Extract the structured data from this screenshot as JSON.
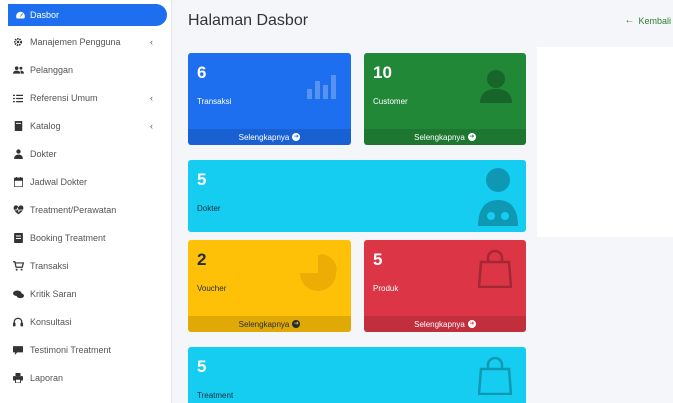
{
  "sidebar": {
    "items": [
      {
        "label": "Dasbor",
        "icon": "dashboard-icon",
        "chevron": false,
        "active": true
      },
      {
        "label": "Manajemen Pengguna",
        "icon": "gear-icon",
        "chevron": true
      },
      {
        "label": "Pelanggan",
        "icon": "users-icon",
        "chevron": false
      },
      {
        "label": "Referensi Umum",
        "icon": "list-icon",
        "chevron": true
      },
      {
        "label": "Katalog",
        "icon": "book-icon",
        "chevron": true
      },
      {
        "label": "Dokter",
        "icon": "doctor-icon",
        "chevron": false
      },
      {
        "label": "Jadwal Dokter",
        "icon": "calendar-icon",
        "chevron": false
      },
      {
        "label": "Treatment/Perawatan",
        "icon": "heartbeat-icon",
        "chevron": false
      },
      {
        "label": "Booking Treatment",
        "icon": "book-open-icon",
        "chevron": false
      },
      {
        "label": "Transaksi",
        "icon": "cart-icon",
        "chevron": false
      },
      {
        "label": "Kritik Saran",
        "icon": "comments-icon",
        "chevron": false
      },
      {
        "label": "Konsultasi",
        "icon": "headset-icon",
        "chevron": false
      },
      {
        "label": "Testimoni Treatment",
        "icon": "comment-icon",
        "chevron": false
      },
      {
        "label": "Laporan",
        "icon": "print-icon",
        "chevron": false
      }
    ],
    "chevron_glyph": "‹"
  },
  "header": {
    "title": "Halaman Dasbor",
    "back_label": "Kembali",
    "back_arrow": "←"
  },
  "boxes": {
    "transaksi": {
      "value": "6",
      "label": "Transaksi",
      "footer": "Selengkapnya",
      "icon": "bar-chart-icon",
      "color": "#1d6ff0"
    },
    "customer": {
      "value": "10",
      "label": "Customer",
      "footer": "Selengkapnya",
      "icon": "user-icon",
      "color": "#218838"
    },
    "dokter": {
      "value": "5",
      "label": "Dokter",
      "icon": "doctor-icon",
      "color": "#14cdf0"
    },
    "voucher": {
      "value": "2",
      "label": "Voucher",
      "footer": "Selengkapnya",
      "icon": "pie-chart-icon",
      "color": "#ffc107"
    },
    "produk": {
      "value": "5",
      "label": "Produk",
      "footer": "Selengkapnya",
      "icon": "shopping-bag-icon",
      "color": "#dc3545"
    },
    "treatment": {
      "value": "5",
      "label": "Treatment",
      "icon": "shopping-bag-icon",
      "color": "#14cdf0"
    }
  }
}
